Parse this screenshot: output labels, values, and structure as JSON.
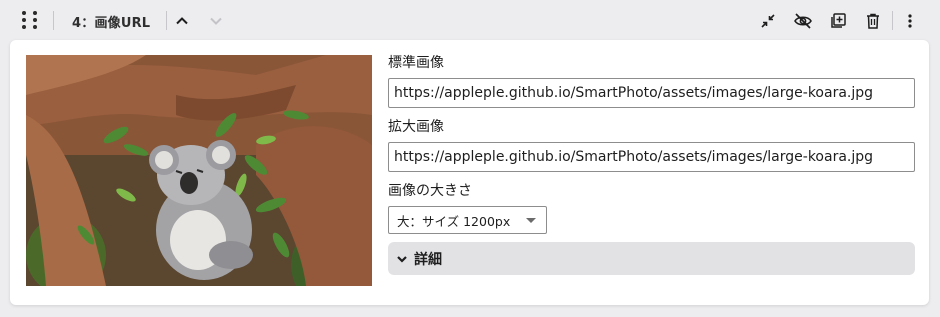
{
  "toolbar": {
    "block_title": "4：画像URL",
    "icons": {
      "drag": "drag-handle-icon",
      "move_up": "chevron-up-icon",
      "move_down": "chevron-down-icon",
      "collapse": "collapse-arrows-icon",
      "hide": "eye-slash-icon",
      "duplicate": "duplicate-plus-icon",
      "delete": "trash-icon",
      "more": "more-vertical-icon"
    },
    "move_down_disabled": true
  },
  "block": {
    "image_alt": "koala in a tree",
    "standard_image": {
      "label": "標準画像",
      "value": "https://appleple.github.io/SmartPhoto/assets/images/large-koara.jpg"
    },
    "large_image": {
      "label": "拡大画像",
      "value": "https://appleple.github.io/SmartPhoto/assets/images/large-koara.jpg"
    },
    "image_size": {
      "label": "画像の大きさ",
      "selected": "大：サイズ 1200px"
    },
    "details": {
      "label": "詳細",
      "icon": "chevron-down-icon"
    }
  },
  "colors": {
    "background": "#ededf0",
    "card": "#ffffff",
    "details_bar": "#e2e2e5",
    "border": "#8d8d8d"
  }
}
